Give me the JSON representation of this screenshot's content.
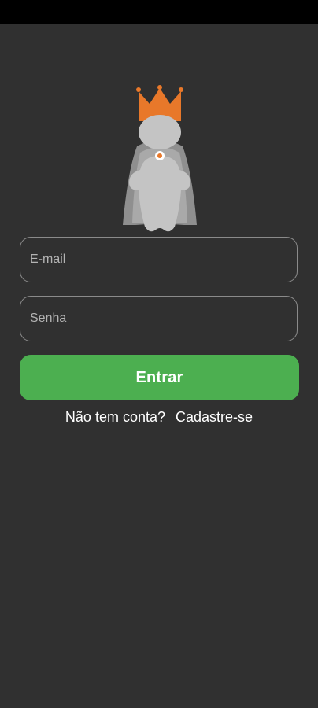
{
  "app": {
    "logo_icon": "crowned-king-icon",
    "colors": {
      "background": "#303030",
      "status_bar": "#000000",
      "accent_green": "#4caf50",
      "crown_orange": "#e8782a",
      "field_border": "#8a8a8a"
    }
  },
  "login": {
    "email_placeholder": "E-mail",
    "password_placeholder": "Senha",
    "submit_label": "Entrar",
    "no_account_text": "Não tem conta?",
    "signup_label": "Cadastre-se"
  }
}
